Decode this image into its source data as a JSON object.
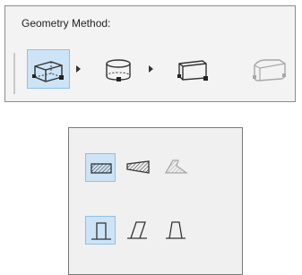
{
  "geometry_panel": {
    "title": "Geometry Method:",
    "methods": [
      {
        "name": "box-method",
        "icon": "box-geometry-icon",
        "selected": true,
        "has_submenu": true
      },
      {
        "name": "cylinder-method",
        "icon": "cylinder-geometry-icon",
        "selected": false,
        "has_submenu": true
      },
      {
        "name": "slanted-box-method",
        "icon": "slanted-box-geometry-icon",
        "selected": false,
        "has_submenu": false
      },
      {
        "name": "rounded-box-method",
        "icon": "rounded-box-geometry-icon",
        "selected": false,
        "disabled": true,
        "has_submenu": false
      }
    ]
  },
  "profile_panel": {
    "rows": [
      [
        {
          "name": "straight-profile",
          "icon": "hatched-rectangle-icon",
          "selected": true
        },
        {
          "name": "tapered-profile",
          "icon": "hatched-trapezoid-icon",
          "selected": false
        },
        {
          "name": "angled-profile",
          "icon": "hatched-angled-shape-icon",
          "selected": false,
          "disabled": true
        }
      ],
      [
        {
          "name": "vertical-wall",
          "icon": "vertical-wall-icon",
          "selected": true
        },
        {
          "name": "slanted-wall",
          "icon": "slanted-wall-icon",
          "selected": false
        },
        {
          "name": "trapezoid-wall",
          "icon": "trapezoid-wall-icon",
          "selected": false
        }
      ]
    ]
  },
  "colors": {
    "selected_bg": "#cde4f7",
    "selected_border": "#8ec0ea",
    "icon_stroke": "#333333",
    "disabled_stroke": "#a8a8a8",
    "panel_bg": "#f3f3f3"
  }
}
